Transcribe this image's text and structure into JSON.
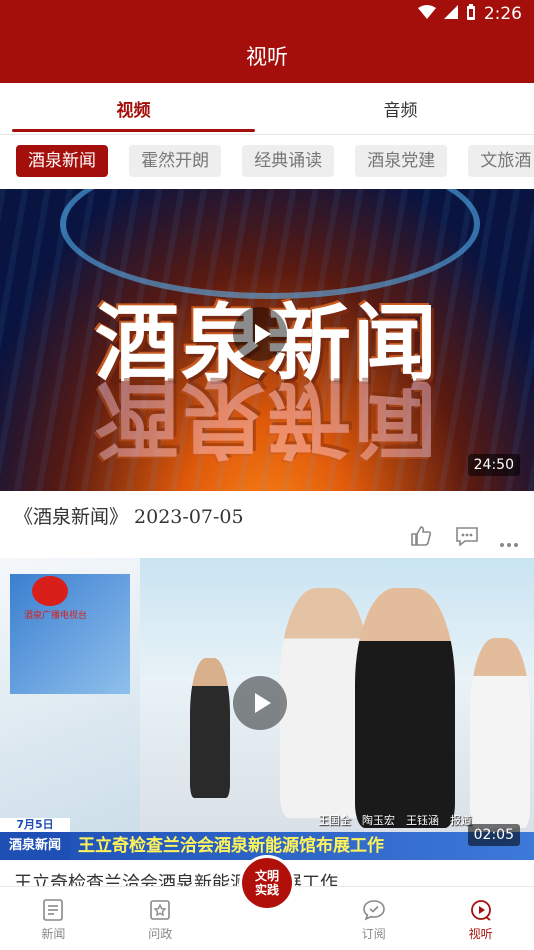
{
  "status": {
    "time": "2:26"
  },
  "header": {
    "title": "视听"
  },
  "tabs": [
    {
      "label": "视频",
      "active": true
    },
    {
      "label": "音频",
      "active": false
    }
  ],
  "categories": [
    {
      "label": "酒泉新闻",
      "active": true
    },
    {
      "label": "霍然开朗"
    },
    {
      "label": "经典诵读"
    },
    {
      "label": "酒泉党建"
    },
    {
      "label": "文旅酒"
    }
  ],
  "videos": [
    {
      "cover_text": "酒泉新闻",
      "duration": "24:50",
      "title": "《酒泉新闻》 2023-07-05"
    },
    {
      "station_logo_text": "酒泉广播电视台",
      "credits": "王国全　陶玉宏　王钰涵　报道",
      "date_tag": "7月5日",
      "program_tag": "酒泉新闻",
      "headline": "王立奇检查兰洽会酒泉新能源馆布展工作",
      "duration": "02:05",
      "title": "王立奇检查兰洽会酒泉新能源馆布展工作"
    }
  ],
  "bottom_nav": [
    {
      "label": "新闻",
      "icon": "news-icon"
    },
    {
      "label": "问政",
      "icon": "inquiry-icon"
    },
    {
      "label": "",
      "center_line1": "文明",
      "center_line2": "实践"
    },
    {
      "label": "订阅",
      "icon": "subscribe-icon"
    },
    {
      "label": "视听",
      "icon": "play-circle-icon",
      "active": true
    }
  ],
  "colors": {
    "brand": "#a50f0b",
    "inactive": "#888888"
  }
}
